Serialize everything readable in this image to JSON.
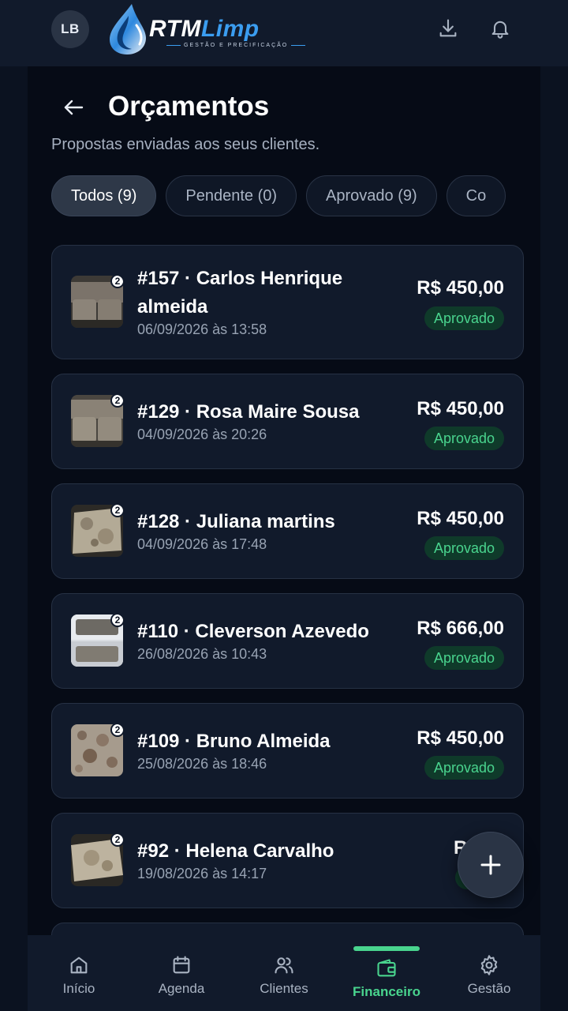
{
  "header": {
    "avatar_initials": "LB",
    "logo": {
      "brand_main": "RTM",
      "brand_accent": "Limp",
      "tagline": "GESTÃO E PRECIFICAÇÃO"
    },
    "icons": {
      "download": "download-icon",
      "notifications": "bell-icon"
    }
  },
  "page": {
    "title": "Orçamentos",
    "subtitle": "Propostas enviadas aos seus clientes."
  },
  "filters": [
    {
      "label": "Todos (9)",
      "active": true
    },
    {
      "label": "Pendente (0)",
      "active": false
    },
    {
      "label": "Aprovado (9)",
      "active": false
    },
    {
      "label": "Co",
      "active": false
    }
  ],
  "quotes": [
    {
      "title": "#157 · Carlos Henrique almeida",
      "date": "06/09/2026 às 13:58",
      "price": "R$ 450,00",
      "status": "Aprovado",
      "photo_count": "2"
    },
    {
      "title": "#129 · Rosa Maire Sousa",
      "date": "04/09/2026 às 20:26",
      "price": "R$ 450,00",
      "status": "Aprovado",
      "photo_count": "2"
    },
    {
      "title": "#128 · Juliana martins",
      "date": "04/09/2026 às 17:48",
      "price": "R$ 450,00",
      "status": "Aprovado",
      "photo_count": "2"
    },
    {
      "title": "#110 · Cleverson Azevedo",
      "date": "26/08/2026 às 10:43",
      "price": "R$ 666,00",
      "status": "Aprovado",
      "photo_count": "2"
    },
    {
      "title": "#109 · Bruno Almeida",
      "date": "25/08/2026 às 18:46",
      "price": "R$ 450,00",
      "status": "Aprovado",
      "photo_count": "2"
    },
    {
      "title": "#92 · Helena Carvalho",
      "date": "19/08/2026 às 14:17",
      "price": "R$ 40",
      "status": "Apro",
      "photo_count": "2"
    }
  ],
  "fab": {
    "icon": "plus-icon"
  },
  "nav": [
    {
      "label": "Início",
      "icon": "home-icon",
      "active": false
    },
    {
      "label": "Agenda",
      "icon": "calendar-icon",
      "active": false
    },
    {
      "label": "Clientes",
      "icon": "users-icon",
      "active": false
    },
    {
      "label": "Financeiro",
      "icon": "wallet-icon",
      "active": true
    },
    {
      "label": "Gestão",
      "icon": "gear-icon",
      "active": false
    }
  ],
  "colors": {
    "background": "#0b1220",
    "panel": "#060b16",
    "card": "#111a2b",
    "accent_green": "#49d48e",
    "brand_blue": "#3b9df0"
  }
}
